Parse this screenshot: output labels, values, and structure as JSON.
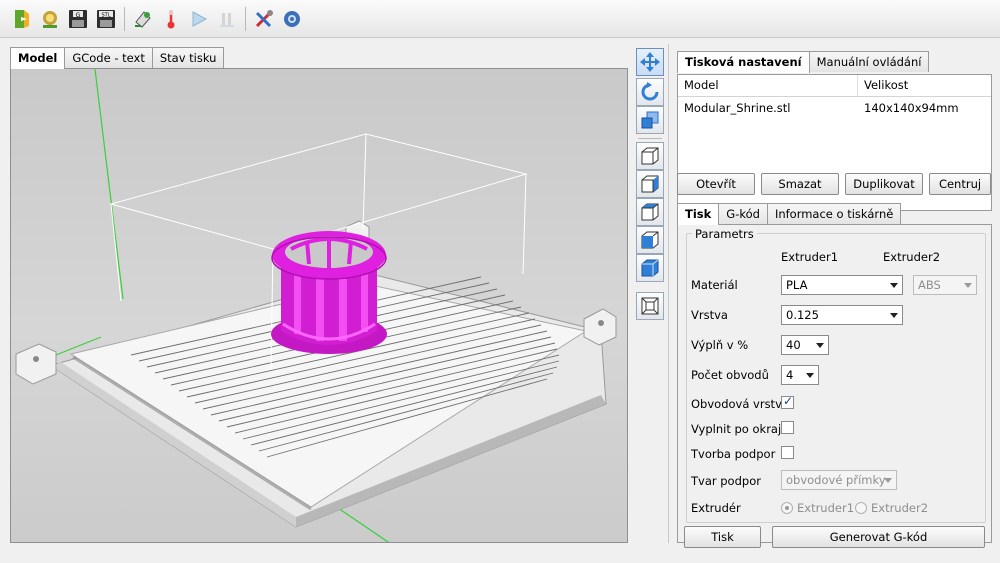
{
  "toolbar": {
    "buttons": [
      "open-icon",
      "load-model-icon",
      "save-gcode-icon",
      "save-stl-icon",
      "slice-icon",
      "temperature-icon",
      "play-icon",
      "pause-icon",
      "tools-icon",
      "settings-icon"
    ],
    "save_gcode_badge": "G",
    "save_stl_badge": "STL"
  },
  "left_tabs": {
    "model": "Model",
    "gcode_text": "GCode - text",
    "print_status": "Stav tisku"
  },
  "right_tabs": {
    "print_settings": "Tisková nastavení",
    "manual_control": "Manuální ovládání"
  },
  "model_table": {
    "headers": {
      "model": "Model",
      "size": "Velikost"
    },
    "rows": [
      {
        "model": "Modular_Shrine.stl",
        "size": "140x140x94mm"
      }
    ]
  },
  "model_buttons": {
    "open": "Otevřít",
    "delete": "Smazat",
    "duplicate": "Duplikovat",
    "center": "Centruj"
  },
  "settings_tabs": {
    "print": "Tisk",
    "gcode": "G-kód",
    "printer_info": "Informace o tiskárně"
  },
  "parameters": {
    "title": "Parametrs",
    "extruder1_header": "Extruder1",
    "extruder2_header": "Extruder2",
    "material_label": "Materiál",
    "material1_value": "PLA",
    "material2_value": "ABS",
    "layer_label": "Vrstva",
    "layer_value": "0.125",
    "infill_label": "Výplň v %",
    "infill_value": "40",
    "perimeters_label": "Počet obvodů",
    "perimeters_value": "4",
    "perimeter_layer_label": "Obvodová vrstva",
    "perimeter_layer_checked": true,
    "fill_to_edge_label": "Vyplnit po okraj",
    "fill_to_edge_checked": false,
    "supports_label": "Tvorba podpor",
    "supports_checked": false,
    "support_shape_label": "Tvar podpor",
    "support_shape_value": "obvodové přímky",
    "extruder_label": "Extrudér",
    "extruder_option1": "Extruder1",
    "extruder_option2": "Extruder2",
    "extruder_selected": "Extruder1"
  },
  "action_buttons": {
    "print": "Tisk",
    "generate_gcode": "Generovat G-kód"
  },
  "colors": {
    "model_magenta": "#e020e0",
    "axis_green": "#3ad03a",
    "view_button_blue": "#2f7fd6"
  }
}
